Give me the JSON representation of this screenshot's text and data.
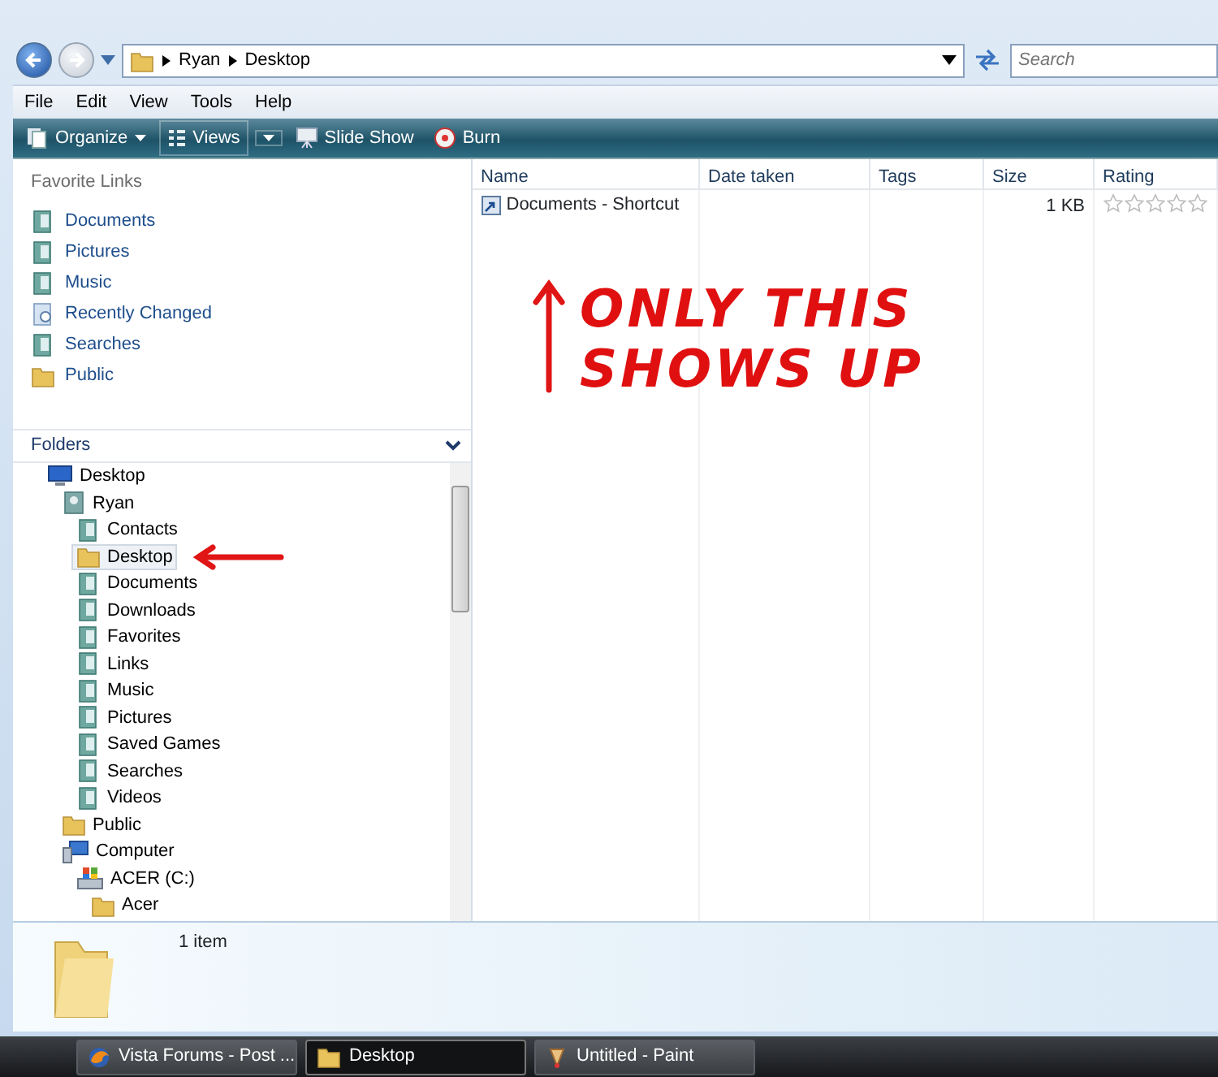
{
  "address_bar": {
    "path": [
      "Ryan",
      "Desktop"
    ],
    "search": {
      "placeholder": "Search"
    }
  },
  "menu_bar": [
    "File",
    "Edit",
    "View",
    "Tools",
    "Help"
  ],
  "toolbar": [
    {
      "label": "Organize",
      "kind": "organize"
    },
    {
      "label": "Views",
      "kind": "views"
    },
    {
      "label": "Slide Show",
      "kind": "slideshow"
    },
    {
      "label": "Burn",
      "kind": "burn"
    }
  ],
  "favorite_links": {
    "title": "Favorite Links",
    "items": [
      {
        "label": "Documents",
        "kind": "special"
      },
      {
        "label": "Pictures",
        "kind": "special"
      },
      {
        "label": "Music",
        "kind": "special"
      },
      {
        "label": "Recently Changed",
        "kind": "recent"
      },
      {
        "label": "Searches",
        "kind": "special"
      },
      {
        "label": "Public",
        "kind": "folder"
      }
    ]
  },
  "folders": {
    "title": "Folders",
    "tree": [
      {
        "label": "Desktop",
        "kind": "desktop",
        "selected": false,
        "children": [
          {
            "label": "Ryan",
            "kind": "user",
            "selected": false,
            "children": [
              {
                "label": "Contacts",
                "kind": "special",
                "selected": false
              },
              {
                "label": "Desktop",
                "kind": "folder",
                "selected": true
              },
              {
                "label": "Documents",
                "kind": "special",
                "selected": false
              },
              {
                "label": "Downloads",
                "kind": "special",
                "selected": false
              },
              {
                "label": "Favorites",
                "kind": "special",
                "selected": false
              },
              {
                "label": "Links",
                "kind": "special",
                "selected": false
              },
              {
                "label": "Music",
                "kind": "special",
                "selected": false
              },
              {
                "label": "Pictures",
                "kind": "special",
                "selected": false
              },
              {
                "label": "Saved Games",
                "kind": "special",
                "selected": false
              },
              {
                "label": "Searches",
                "kind": "special",
                "selected": false
              },
              {
                "label": "Videos",
                "kind": "special",
                "selected": false
              }
            ]
          },
          {
            "label": "Public",
            "kind": "folder",
            "selected": false
          },
          {
            "label": "Computer",
            "kind": "computer",
            "selected": false,
            "children": [
              {
                "label": "ACER (C:)",
                "kind": "drive",
                "selected": false,
                "children": [
                  {
                    "label": "Acer",
                    "kind": "folder",
                    "selected": false
                  }
                ]
              }
            ]
          }
        ]
      }
    ]
  },
  "file_list": {
    "columns": [
      "Name",
      "Date taken",
      "Tags",
      "Size",
      "Rating"
    ],
    "rows": [
      {
        "name": "Documents - Shortcut",
        "date_taken": "",
        "tags": "",
        "size": "1 KB",
        "stars": 0
      }
    ]
  },
  "annotations": [
    {
      "kind": "arrow_up_text",
      "lines": [
        "ONLY THIS",
        "SHOWS UP"
      ]
    },
    {
      "kind": "arrow_left"
    }
  ],
  "details_pane": {
    "text": "1 item"
  },
  "taskbar": [
    {
      "label": "Vista Forums - Post ...",
      "kind": "browser",
      "selected": false
    },
    {
      "label": "Desktop",
      "kind": "folder",
      "selected": true
    },
    {
      "label": "Untitled - Paint",
      "kind": "paint",
      "selected": false
    }
  ]
}
